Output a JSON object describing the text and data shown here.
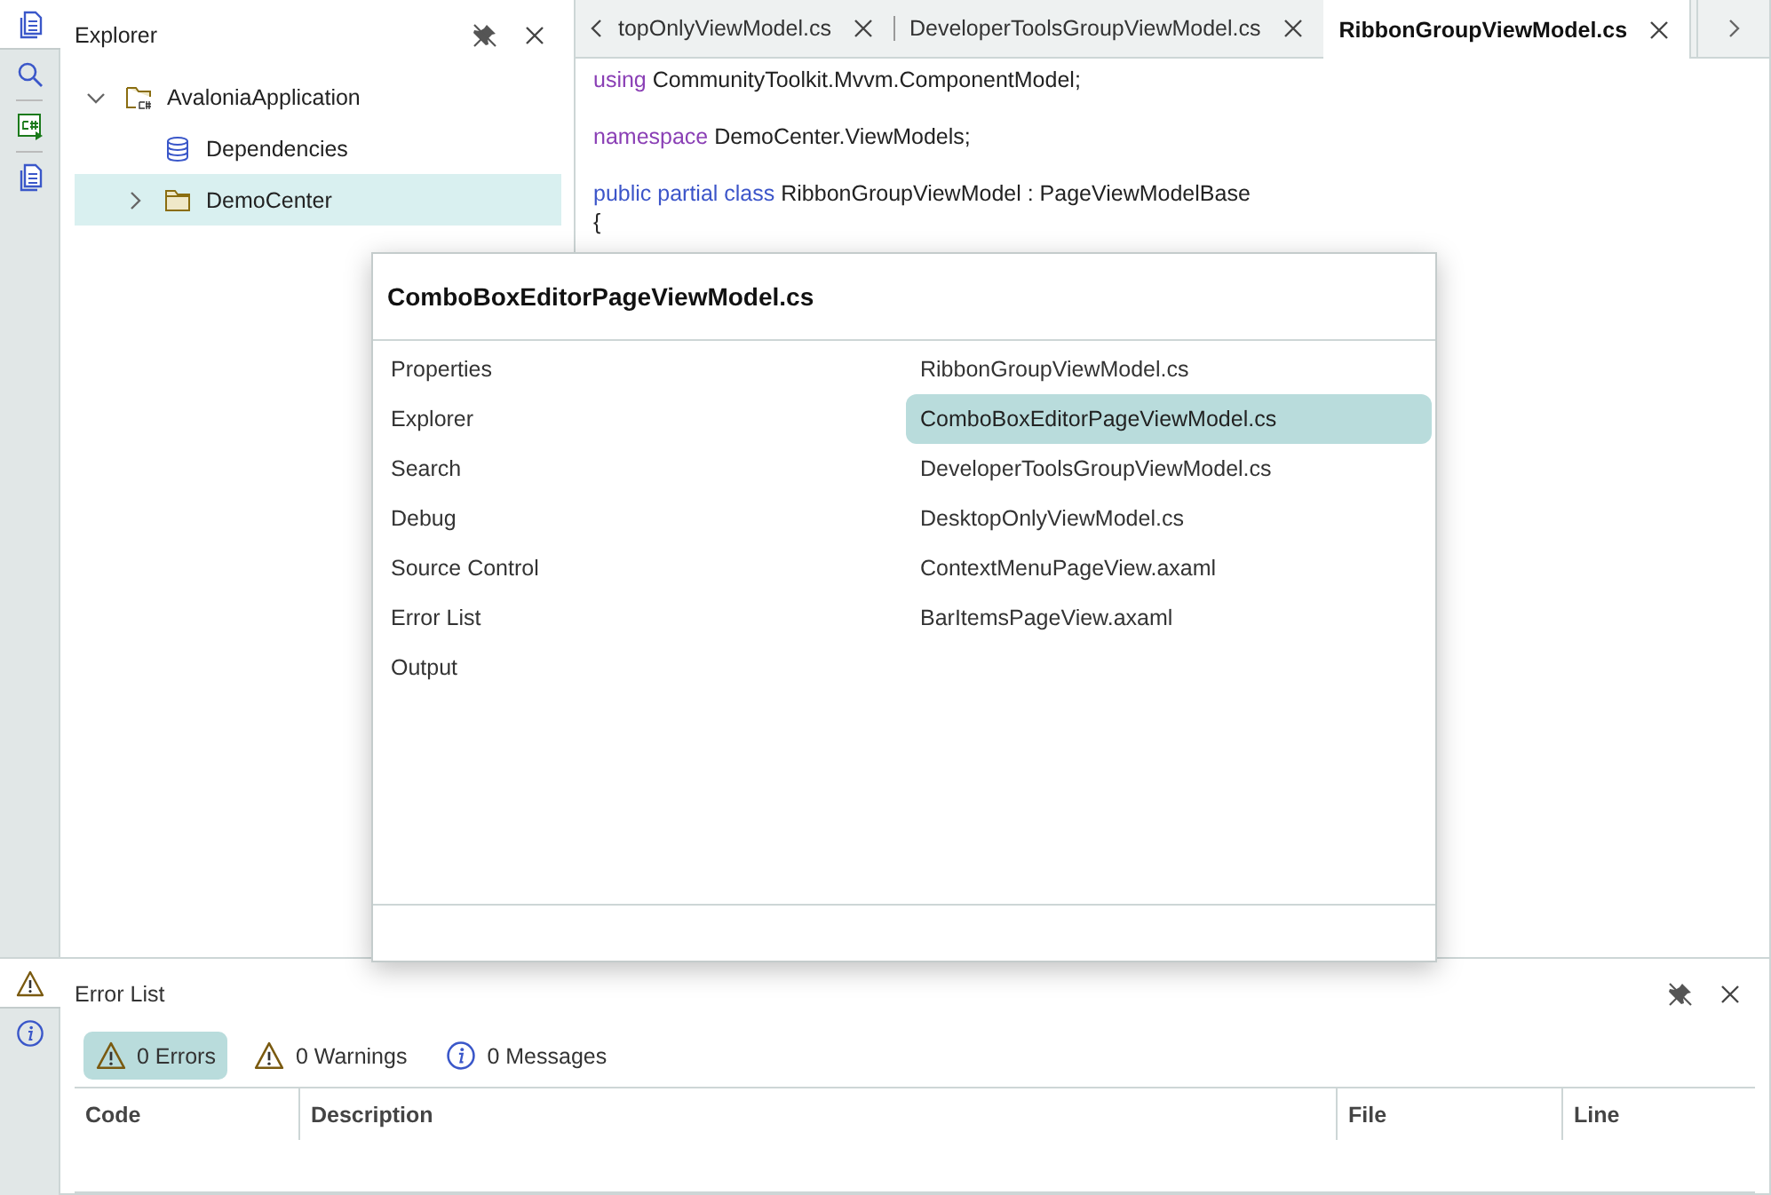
{
  "side_tabs_top": [
    {
      "kind": "document",
      "selected": true
    },
    {
      "kind": "search",
      "selected": false
    },
    {
      "kind": "csharp",
      "selected": false
    },
    {
      "kind": "document",
      "selected": false
    }
  ],
  "side_tabs_bottom": [
    {
      "kind": "warning",
      "selected": true
    },
    {
      "kind": "info",
      "selected": false
    }
  ],
  "explorer": {
    "title": "Explorer",
    "tree": [
      {
        "label": "AvaloniaApplication",
        "kind": "project",
        "expanded": true,
        "selected": false,
        "children": [
          {
            "label": "Dependencies",
            "kind": "dependencies",
            "selected": false
          },
          {
            "label": "DemoCenter",
            "kind": "folder",
            "expanded": false,
            "selected": true
          }
        ]
      }
    ]
  },
  "editor": {
    "tabs": [
      {
        "label": "topOnlyViewModel.cs",
        "selected": false
      },
      {
        "label": "DeveloperToolsGroupViewModel.cs",
        "selected": false
      },
      {
        "label": "RibbonGroupViewModel.cs",
        "selected": true
      }
    ],
    "code_blocks": [
      [
        [
          {
            "kind": "directive",
            "text": "using"
          },
          {
            "kind": "text",
            "text": " CommunityToolkit.Mvvm.ComponentModel;"
          }
        ]
      ],
      [
        [
          {
            "kind": "directive",
            "text": "namespace"
          },
          {
            "kind": "text",
            "text": " DemoCenter.ViewModels;"
          }
        ]
      ],
      [
        [
          {
            "kind": "keyword",
            "text": "public partial class"
          },
          {
            "kind": "text",
            "text": " RibbonGroupViewModel : PageViewModelBase"
          }
        ],
        [
          {
            "kind": "text",
            "text": "{"
          }
        ]
      ]
    ]
  },
  "switcher": {
    "title": "ComboBoxEditorPageViewModel.cs",
    "tool_windows": [
      "Properties",
      "Explorer",
      "Search",
      "Debug",
      "Source Control",
      "Error List",
      "Output"
    ],
    "files": [
      {
        "label": "RibbonGroupViewModel.cs",
        "selected": false
      },
      {
        "label": "ComboBoxEditorPageViewModel.cs",
        "selected": true
      },
      {
        "label": "DeveloperToolsGroupViewModel.cs",
        "selected": false
      },
      {
        "label": "DesktopOnlyViewModel.cs",
        "selected": false
      },
      {
        "label": "ContextMenuPageView.axaml",
        "selected": false
      },
      {
        "label": "BarItemsPageView.axaml",
        "selected": false
      }
    ]
  },
  "error_list": {
    "title": "Error List",
    "filters": [
      {
        "kind": "warning",
        "label": "0 Errors",
        "selected": true
      },
      {
        "kind": "warning",
        "label": "0 Warnings",
        "selected": false
      },
      {
        "kind": "info",
        "label": "0 Messages",
        "selected": false
      }
    ],
    "columns": [
      "Code",
      "Description",
      "File",
      "Line"
    ]
  }
}
